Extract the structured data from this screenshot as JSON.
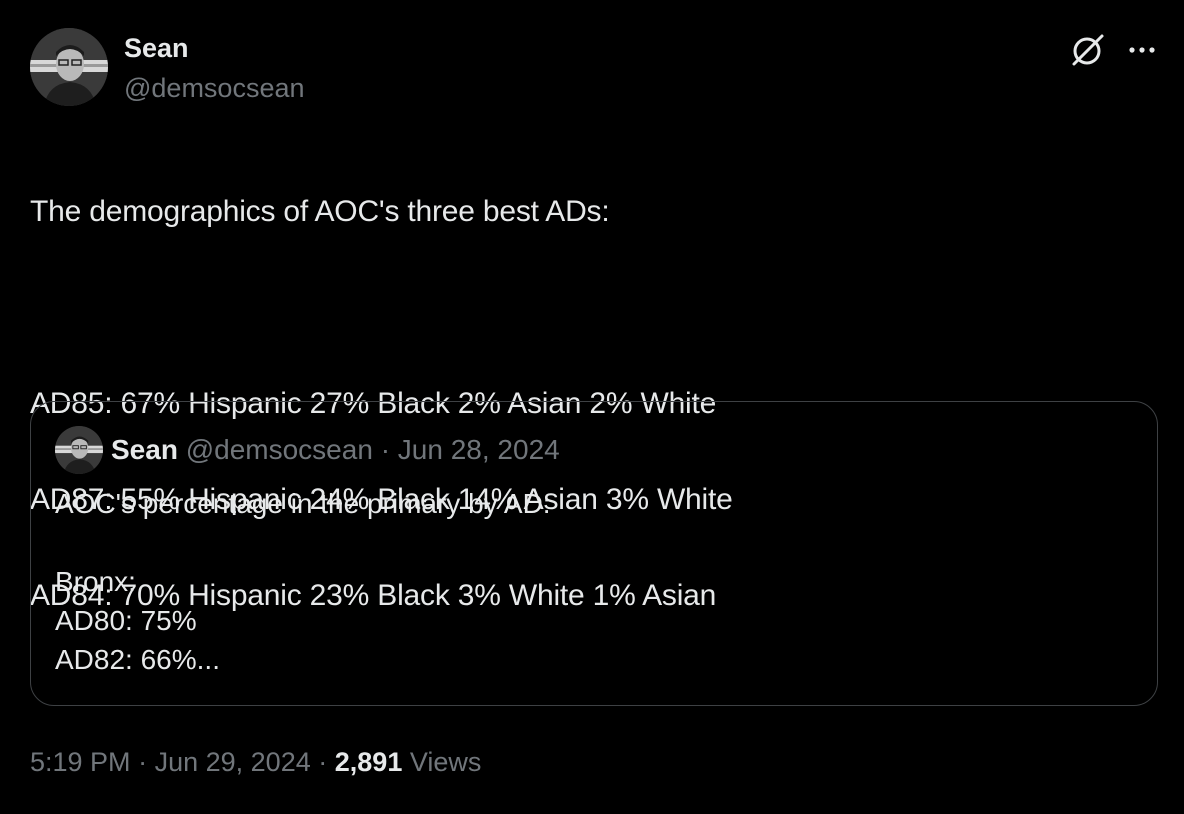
{
  "author": {
    "name": "Sean",
    "handle": "@demsocsean"
  },
  "icons": {
    "grok": "grok-icon",
    "more": "more-horizontal-icon"
  },
  "tweet": {
    "lines": [
      "The demographics of AOC's three best ADs:",
      "",
      "AD85: 67% Hispanic 27% Black 2% Asian 2% White",
      "AD87: 55% Hispanic 24% Black 14% Asian 3% White",
      "AD84: 70% Hispanic 23% Black 3% White 1% Asian"
    ]
  },
  "quote": {
    "name": "Sean",
    "handle": "@demsocsean",
    "separator": "·",
    "date": "Jun 28, 2024",
    "lines": [
      "AOC's percentage in the primary by AD:",
      "",
      "Bronx:",
      "AD80: 75%",
      "AD82: 66%..."
    ]
  },
  "meta": {
    "time": "5:19 PM",
    "separator": "·",
    "date": "Jun 29, 2024",
    "views_count": "2,891",
    "views_label": "Views"
  },
  "colors": {
    "background": "#000000",
    "text_primary": "#e7e9ea",
    "text_secondary": "#71767b",
    "border": "#3e4144"
  }
}
